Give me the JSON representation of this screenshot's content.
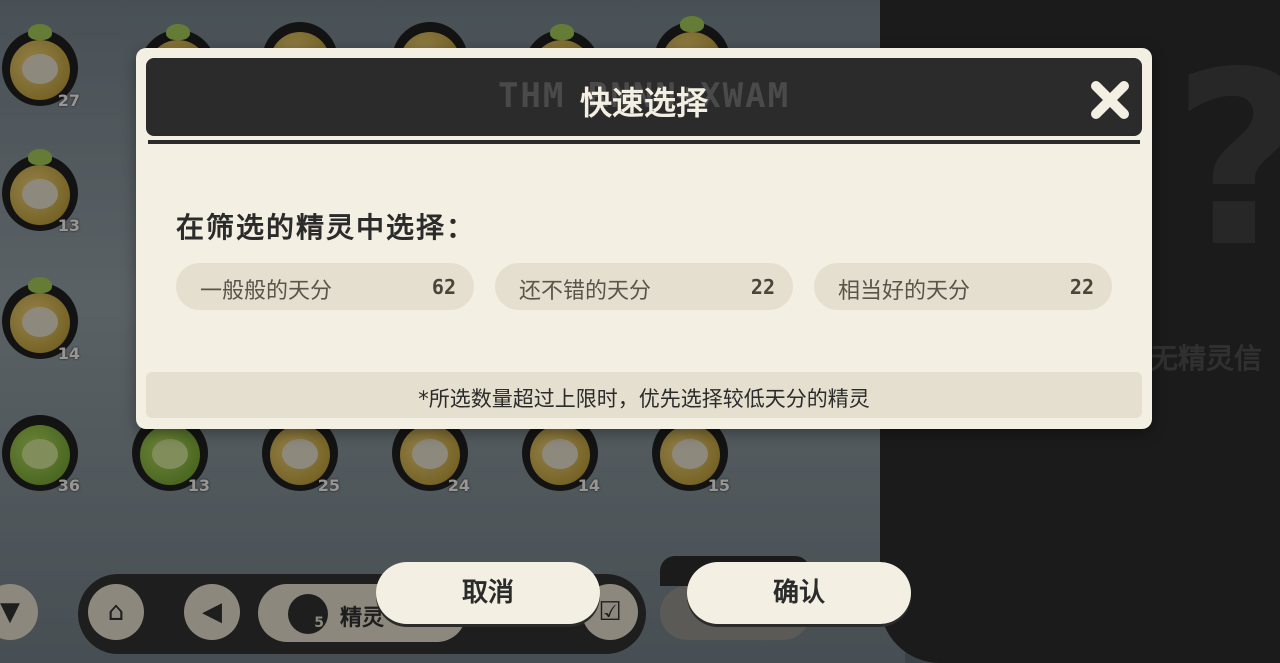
{
  "dialog": {
    "title": "快速选择",
    "header_decoration": "THM RNNN+XWAM",
    "section_label": "在筛选的精灵中选择：",
    "options": [
      {
        "label": "一般般的天分",
        "count": "62"
      },
      {
        "label": "还不错的天分",
        "count": "22"
      },
      {
        "label": "相当好的天分",
        "count": "22"
      }
    ],
    "note": "*所选数量超过上限时，优先选择较低天分的精灵"
  },
  "buttons": {
    "cancel": "取消",
    "confirm": "确认"
  },
  "background": {
    "sprite_levels": [
      "27",
      "13",
      "14",
      "36",
      "13",
      "25",
      "24",
      "14",
      "15"
    ],
    "toolbar_label": "精灵",
    "toolbar_badge": "5",
    "panel_text": "无精灵信",
    "panel_icon": "question-mark"
  },
  "colors": {
    "dialog_bg": "#f3efe2",
    "header_bg": "#2b2b2b",
    "option_bg": "#e5dfcf"
  }
}
